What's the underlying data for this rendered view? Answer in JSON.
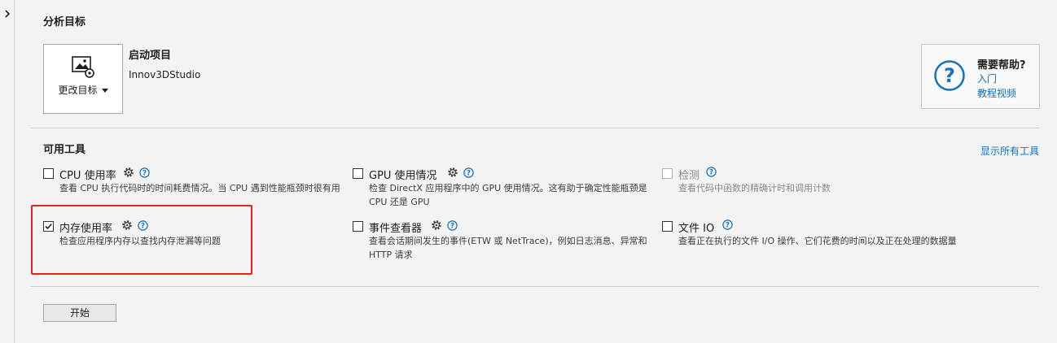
{
  "target": {
    "section_title": "分析目标",
    "change_target_label": "更改目标",
    "project_title": "启动项目",
    "project_name": "Innov3DStudio"
  },
  "help": {
    "title": "需要帮助?",
    "link_intro": "入门",
    "link_video": "教程视频"
  },
  "tools": {
    "section_title": "可用工具",
    "show_all": "显示所有工具",
    "items": [
      {
        "name": "CPU 使用率",
        "checked": false,
        "enabled": true,
        "has_gear": true,
        "desc": "查看 CPU 执行代码时的时间耗费情况。当 CPU 遇到性能瓶颈时很有用"
      },
      {
        "name": "GPU 使用情况",
        "checked": false,
        "enabled": true,
        "has_gear": true,
        "desc": "检查 DirectX 应用程序中的 GPU 使用情况。这有助于确定性能瓶颈是 CPU 还是 GPU"
      },
      {
        "name": "检测",
        "checked": false,
        "enabled": false,
        "has_gear": false,
        "desc": "查看代码中函数的精确计时和调用计数"
      },
      {
        "name": "内存使用率",
        "checked": true,
        "enabled": true,
        "has_gear": true,
        "desc": "检查应用程序内存以查找内存泄漏等问题"
      },
      {
        "name": "事件查看器",
        "checked": false,
        "enabled": true,
        "has_gear": true,
        "desc": "查看会话期间发生的事件(ETW 或 NetTrace)，例如日志消息、异常和 HTTP 请求"
      },
      {
        "name": "文件 IO",
        "checked": false,
        "enabled": true,
        "has_gear": false,
        "desc": "查看正在执行的文件 I/O 操作、它们花费的时间以及正在处理的数据量"
      }
    ]
  },
  "start_button": "开始",
  "colors": {
    "link": "#0e70c0",
    "highlight": "#e8211c",
    "help_icon": "#1a73b8"
  }
}
